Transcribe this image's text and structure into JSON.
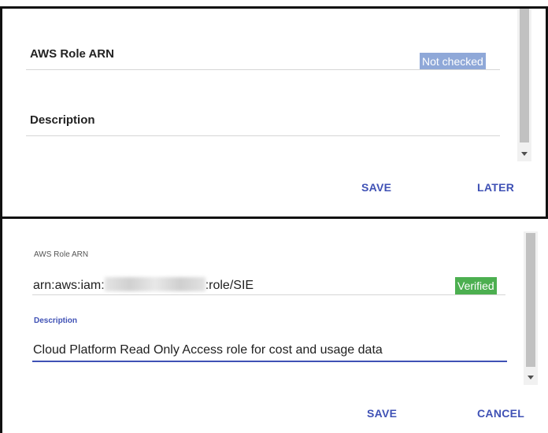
{
  "top_form": {
    "role_arn_label": "AWS Role ARN",
    "role_arn_value": "",
    "status_badge": "Not checked",
    "status_color": "#8fa8d8",
    "description_label": "Description",
    "description_value": "",
    "save_label": "SAVE",
    "later_label": "LATER"
  },
  "bottom_form": {
    "role_arn_label": "AWS Role ARN",
    "role_arn_prefix": "arn:aws:iam:",
    "role_arn_suffix": ":role/SIE",
    "status_badge": "Verified",
    "status_color": "#4caf50",
    "description_label": "Description",
    "description_value": "Cloud Platform Read Only Access role for cost and usage data",
    "save_label": "SAVE",
    "cancel_label": "CANCEL"
  },
  "colors": {
    "accent": "#3f51b5",
    "frame": "#111111"
  }
}
